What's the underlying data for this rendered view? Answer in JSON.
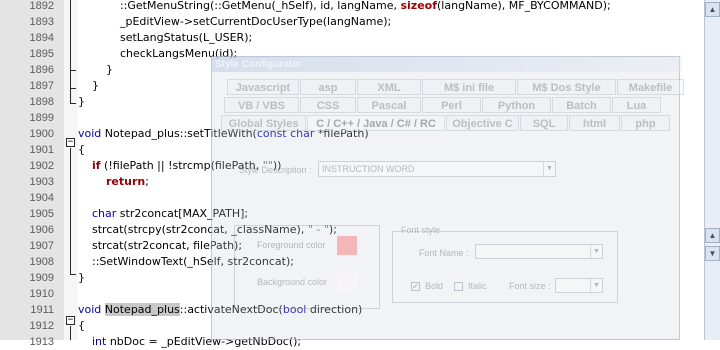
{
  "editor": {
    "line_numbers": [
      "1892",
      "1893",
      "1894",
      "1895",
      "1896",
      "1897",
      "1898",
      "1899",
      "1900",
      "1901",
      "1902",
      "1903",
      "1904",
      "1905",
      "1906",
      "1907",
      "1908",
      "1909",
      "1910",
      "1911",
      "1912",
      "1913"
    ],
    "lines": [
      {
        "id": "l1892",
        "indent": "            ",
        "parts": [
          {
            "t": "::GetMenuString(::GetMenu(_hSelf), id, langName, ",
            "c": ""
          },
          {
            "t": "sizeof",
            "c": "kwr"
          },
          {
            "t": "(langName), MF_BYCOMMAND);",
            "c": ""
          }
        ]
      },
      {
        "id": "l1893",
        "indent": "            ",
        "parts": [
          {
            "t": "_pEditView->setCurrentDocUserType(langName);",
            "c": ""
          }
        ]
      },
      {
        "id": "l1894",
        "indent": "            ",
        "parts": [
          {
            "t": "setLangStatus(L_USER);",
            "c": ""
          }
        ]
      },
      {
        "id": "l1895",
        "indent": "            ",
        "parts": [
          {
            "t": "checkLangsMenu(id);",
            "c": ""
          }
        ]
      },
      {
        "id": "l1896",
        "indent": "        ",
        "parts": [
          {
            "t": "}",
            "c": ""
          }
        ]
      },
      {
        "id": "l1897",
        "indent": "    ",
        "parts": [
          {
            "t": "}",
            "c": ""
          }
        ]
      },
      {
        "id": "l1898",
        "indent": "",
        "parts": [
          {
            "t": "}",
            "c": ""
          }
        ]
      },
      {
        "id": "l1899",
        "indent": "",
        "parts": []
      },
      {
        "id": "l1900",
        "indent": "",
        "parts": [
          {
            "t": "void",
            "c": "kw"
          },
          {
            "t": " Notepad_plus::setTitleWith(",
            "c": ""
          },
          {
            "t": "const char",
            "c": "kw"
          },
          {
            "t": " *filePath)",
            "c": ""
          }
        ]
      },
      {
        "id": "l1901",
        "indent": "",
        "parts": [
          {
            "t": "{",
            "c": ""
          }
        ]
      },
      {
        "id": "l1902",
        "indent": "    ",
        "parts": [
          {
            "t": "if",
            "c": "kwr"
          },
          {
            "t": " (!filePath || !strcmp(filePath, ",
            "c": ""
          },
          {
            "t": "\"\"",
            "c": "str"
          },
          {
            "t": "))",
            "c": ""
          }
        ]
      },
      {
        "id": "l1903",
        "indent": "        ",
        "parts": [
          {
            "t": "return",
            "c": "kwr"
          },
          {
            "t": ";",
            "c": ""
          }
        ]
      },
      {
        "id": "l1904",
        "indent": "",
        "parts": []
      },
      {
        "id": "l1905",
        "indent": "    ",
        "parts": [
          {
            "t": "char",
            "c": "kw"
          },
          {
            "t": " str2concat[MAX_PATH];",
            "c": ""
          }
        ]
      },
      {
        "id": "l1906",
        "indent": "    ",
        "parts": [
          {
            "t": "strcat(strcpy(str2concat, _className), ",
            "c": ""
          },
          {
            "t": "\" - \"",
            "c": "str"
          },
          {
            "t": ");",
            "c": ""
          }
        ]
      },
      {
        "id": "l1907",
        "indent": "    ",
        "parts": [
          {
            "t": "strcat(str2concat, filePath);",
            "c": ""
          }
        ]
      },
      {
        "id": "l1908",
        "indent": "    ",
        "parts": [
          {
            "t": "::SetWindowText(_hSelf, str2concat);",
            "c": ""
          }
        ]
      },
      {
        "id": "l1909",
        "indent": "",
        "parts": [
          {
            "t": "}",
            "c": ""
          }
        ]
      },
      {
        "id": "l1910",
        "indent": "",
        "parts": []
      },
      {
        "id": "l1911",
        "indent": "",
        "parts": [
          {
            "t": "void",
            "c": "kw"
          },
          {
            "t": " ",
            "c": ""
          },
          {
            "t": "Notepad_plus",
            "c": "hl"
          },
          {
            "t": "::activateNextDoc(",
            "c": ""
          },
          {
            "t": "bool",
            "c": "kw"
          },
          {
            "t": " direction)",
            "c": ""
          }
        ]
      },
      {
        "id": "l1912",
        "indent": "",
        "parts": [
          {
            "t": "{",
            "c": ""
          }
        ]
      },
      {
        "id": "l1913",
        "indent": "    ",
        "parts": [
          {
            "t": "int",
            "c": "kw"
          },
          {
            "t": " nbDoc = _pEditView->getNbDoc();",
            "c": ""
          }
        ]
      }
    ]
  },
  "style_configurator": {
    "title": "Style Configurator",
    "tabs_row1": [
      "Javascript",
      "asp",
      "XML",
      "M$ ini file",
      "M$ Dos Style",
      "Makefile"
    ],
    "tabs_row2": [
      "VB / VBS",
      "CSS",
      "Pascal",
      "Perl",
      "Python",
      "Batch",
      "Lua"
    ],
    "tabs_row3": [
      "Global Styles",
      "C / C++ / Java / C# / RC",
      "Objective C",
      "SQL",
      "html",
      "php"
    ],
    "style_description_label": "Style Description :",
    "style_description_value": "INSTRUCTION WORD",
    "foreground_label": "Foreground color",
    "background_label": "Background color",
    "foreground_color": "#f4b6b6",
    "background_color": "#f6f4f6",
    "font_style_label": "Font style",
    "font_name_label": "Font Name :",
    "bold_label": "Bold",
    "bold_checked": true,
    "italic_label": "Italic",
    "italic_checked": false,
    "font_size_label": "Font size :"
  }
}
